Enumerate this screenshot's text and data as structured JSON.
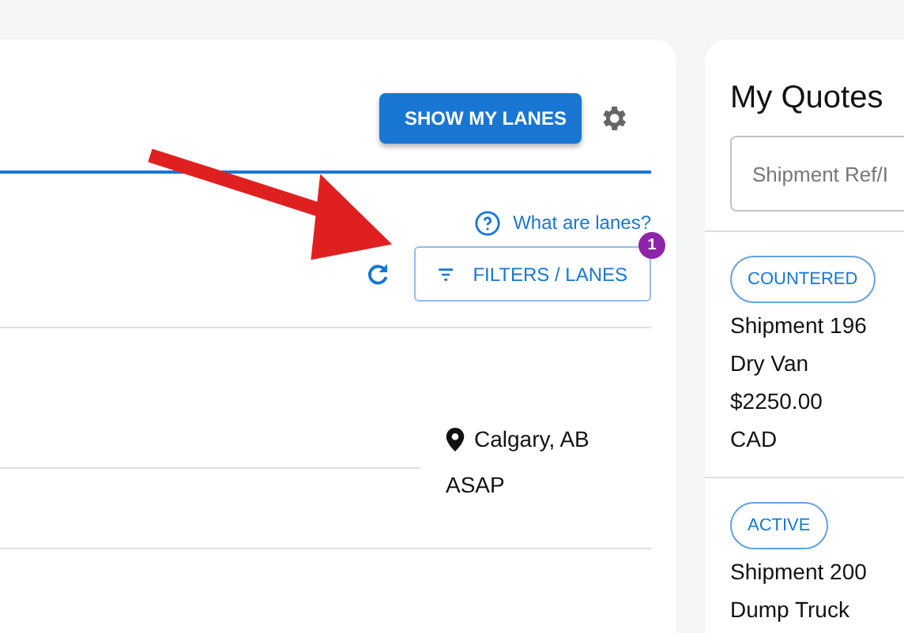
{
  "lanes_panel": {
    "show_lanes_button": "SHOW MY LANES",
    "help_link": "What are lanes?",
    "filters_button": "FILTERS / LANES",
    "filters_badge": "1",
    "rows": [
      {
        "location": "Calgary, AB",
        "timing": "ASAP"
      }
    ]
  },
  "quotes_panel": {
    "title": "My Quotes",
    "search": {
      "placeholder": "Shipment Ref/I"
    },
    "quotes": [
      {
        "status": "COUNTERED",
        "lines": [
          "Shipment 196",
          "Dry Van",
          "$2250.00",
          "CAD"
        ]
      },
      {
        "status": "ACTIVE",
        "lines": [
          "Shipment 200",
          "Dump Truck"
        ]
      }
    ]
  }
}
